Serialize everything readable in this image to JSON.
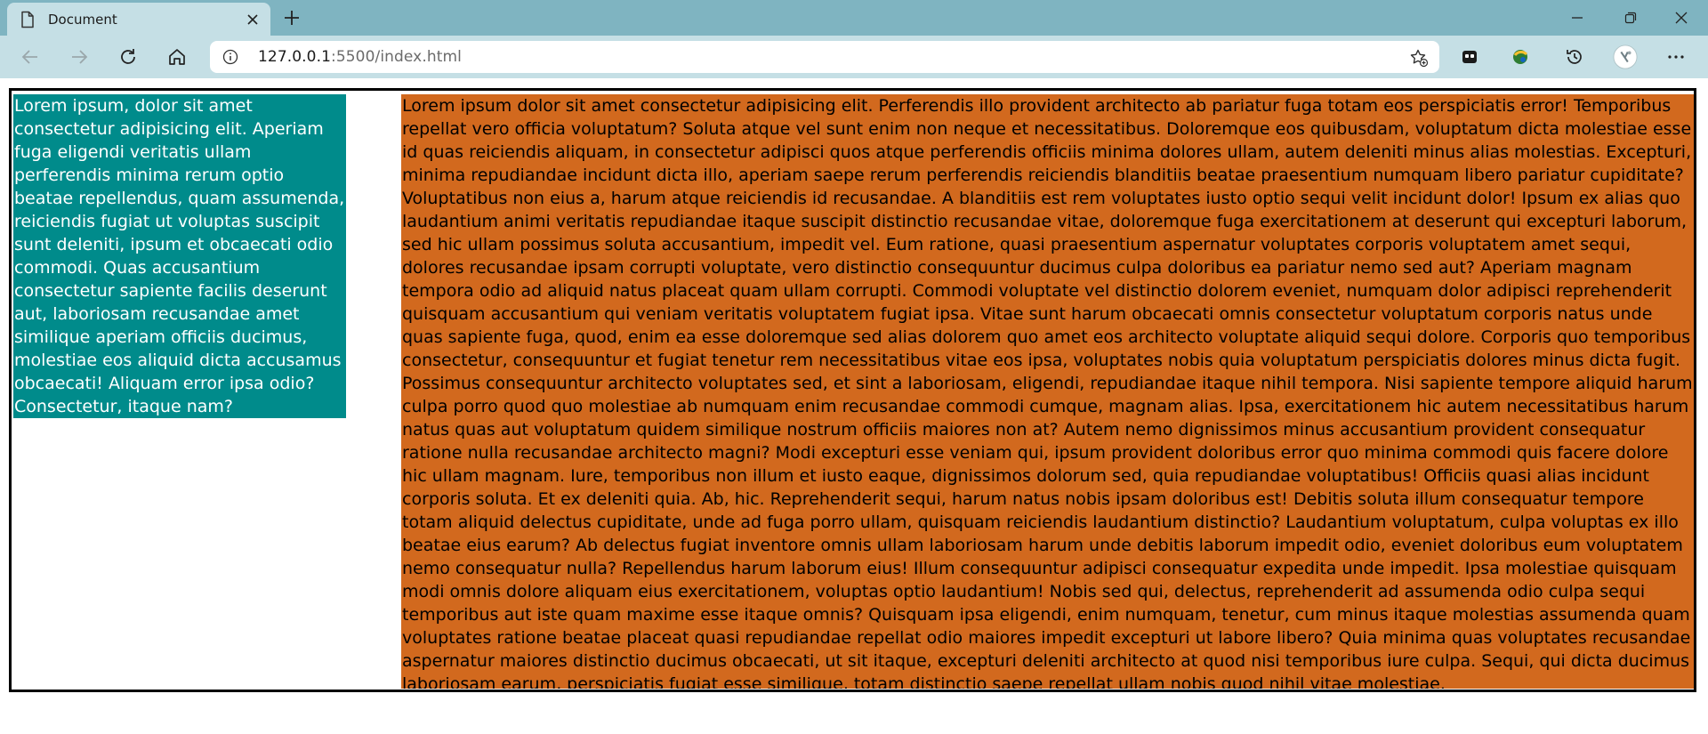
{
  "browser": {
    "tab_title": "Document",
    "url_host": "127.0.0.1",
    "url_path": ":5500/index.html",
    "frame_color": "#7fb4c1",
    "toolbar_color": "#c5dfe5"
  },
  "page": {
    "sidebar_text": "Lorem ipsum, dolor sit amet consectetur adipisicing elit. Aperiam fuga eligendi veritatis ullam perferendis minima rerum optio beatae repellendus, quam assumenda, reiciendis fugiat ut voluptas suscipit sunt deleniti, ipsum et obcaecati odio commodi. Quas accusantium consectetur sapiente facilis deserunt aut, laboriosam recusandae amet similique aperiam officiis ducimus, molestiae eos aliquid dicta accusamus obcaecati! Aliquam error ipsa odio? Consectetur, itaque nam?",
    "sidebar_color": "#008b8b",
    "main_text": "Lorem ipsum dolor sit amet consectetur adipisicing elit. Perferendis illo provident architecto ab pariatur fuga totam eos perspiciatis error! Temporibus repellat vero officia voluptatum? Soluta atque vel sunt enim non neque et necessitatibus. Doloremque eos quibusdam, voluptatum dicta molestiae esse id quas reiciendis aliquam, in consectetur adipisci quos atque perferendis officiis minima dolores ullam, autem deleniti minus alias molestias. Excepturi, minima repudiandae incidunt dicta illo, aperiam saepe rerum perferendis reiciendis blanditiis beatae praesentium numquam libero pariatur cupiditate? Voluptatibus non eius a, harum atque reiciendis id recusandae. A blanditiis est rem voluptates iusto optio sequi velit incidunt dolor! Ipsum ex alias quo laudantium animi veritatis repudiandae itaque suscipit distinctio recusandae vitae, doloremque fuga exercitationem at deserunt qui excepturi laborum, sed hic ullam possimus soluta accusantium, impedit vel. Eum ratione, quasi praesentium aspernatur voluptates corporis voluptatem amet sequi, dolores recusandae ipsam corrupti voluptate, vero distinctio consequuntur ducimus culpa doloribus ea pariatur nemo sed aut? Aperiam magnam tempora odio ad aliquid natus placeat quam ullam corrupti. Commodi voluptate vel distinctio dolorem eveniet, numquam dolor adipisci reprehenderit quisquam accusantium qui veniam veritatis voluptatem fugiat ipsa. Vitae sunt harum obcaecati omnis consectetur voluptatum corporis natus unde quas sapiente fuga, quod, enim ea esse doloremque sed alias dolorem quo amet eos architecto voluptate aliquid sequi dolore. Corporis quo temporibus consectetur, consequuntur et fugiat tenetur rem necessitatibus vitae eos ipsa, voluptates nobis quia voluptatum perspiciatis dolores minus dicta fugit. Possimus consequuntur architecto voluptates sed, et sint a laboriosam, eligendi, repudiandae itaque nihil tempora. Nisi sapiente tempore aliquid harum culpa porro quod quo molestiae ab numquam enim recusandae commodi cumque, magnam alias. Ipsa, exercitationem hic autem necessitatibus harum natus quas aut voluptatum quidem similique nostrum officiis maiores non at? Autem nemo dignissimos minus accusantium provident consequatur ratione nulla recusandae architecto magni? Modi excepturi esse veniam qui, ipsum provident doloribus error quo minima commodi quis facere dolore hic ullam magnam. Iure, temporibus non illum et iusto eaque, dignissimos dolorum sed, quia repudiandae voluptatibus! Officiis quasi alias incidunt corporis soluta. Et ex deleniti quia. Ab, hic. Reprehenderit sequi, harum natus nobis ipsam doloribus est! Debitis soluta illum consequatur tempore totam aliquid delectus cupiditate, unde ad fuga porro ullam, quisquam reiciendis laudantium distinctio? Laudantium voluptatum, culpa voluptas ex illo beatae eius earum? Ab delectus fugiat inventore omnis ullam laboriosam harum unde debitis laborum impedit odio, eveniet doloribus eum voluptatem nemo consequatur nulla? Repellendus harum laborum eius! Illum consequuntur adipisci consequatur expedita unde impedit. Ipsa molestiae quisquam modi omnis dolore aliquam eius exercitationem, voluptas optio laudantium! Nobis sed qui, delectus, reprehenderit ad assumenda odio culpa sequi temporibus aut iste quam maxime esse itaque omnis? Quisquam ipsa eligendi, enim numquam, tenetur, cum minus itaque molestias assumenda quam voluptates ratione beatae placeat quasi repudiandae repellat odio maiores impedit excepturi ut labore libero? Quia minima quas voluptates recusandae aspernatur maiores distinctio ducimus obcaecati, ut sit itaque, excepturi deleniti architecto at quod nisi temporibus iure culpa. Sequi, qui dicta ducimus laboriosam earum, perspiciatis fugiat esse similique, totam distinctio saepe repellat ullam nobis quod nihil vitae molestiae.",
    "main_color": "#d2691e"
  },
  "icons": {
    "tab": "document-icon",
    "close_tab": "close-icon",
    "new_tab": "plus-icon",
    "minimize": "minimize-icon",
    "restore": "restore-icon",
    "close_window": "close-icon",
    "back": "back-arrow-icon",
    "forward": "forward-arrow-icon",
    "refresh": "refresh-icon",
    "home": "home-icon",
    "site_info": "info-icon",
    "favorite": "star-add-icon",
    "collections": "collections-icon",
    "extension": "extension-icon",
    "history": "history-icon",
    "profile": "profile-avatar-icon",
    "menu": "more-icon"
  }
}
